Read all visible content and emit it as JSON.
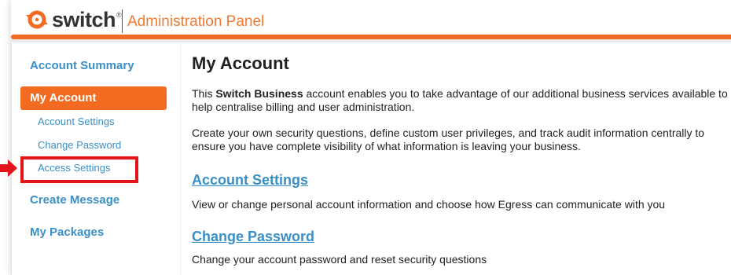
{
  "header": {
    "brand": "switch",
    "trademark": "®",
    "panel_title": "Administration Panel"
  },
  "sidebar": {
    "account_summary": "Account Summary",
    "my_account": "My Account",
    "sub_items": [
      "Account Settings",
      "Change Password",
      "Access Settings"
    ],
    "create_message": "Create Message",
    "my_packages": "My Packages"
  },
  "main": {
    "title": "My Account",
    "intro_prefix": "This ",
    "intro_bold": "Switch Business",
    "intro_suffix": " account enables you to take advantage of our additional business services available to help centralise billing and user administration.",
    "para2": "Create your own security questions, define custom user privileges, and track audit information centrally to ensure you have complete visibility of what information is leaving your business.",
    "sections": [
      {
        "heading": "Account Settings",
        "description": "View or change personal account information and choose how Egress can communicate with you"
      },
      {
        "heading": "Change Password",
        "description": "Change your account password and reset security questions"
      }
    ]
  },
  "colors": {
    "accent": "#f26b21",
    "link": "#3a8fc7",
    "annotation": "#e4141b"
  },
  "icons": {
    "logo": "switch-logo-icon",
    "annotation_arrow": "red-arrow-icon"
  }
}
